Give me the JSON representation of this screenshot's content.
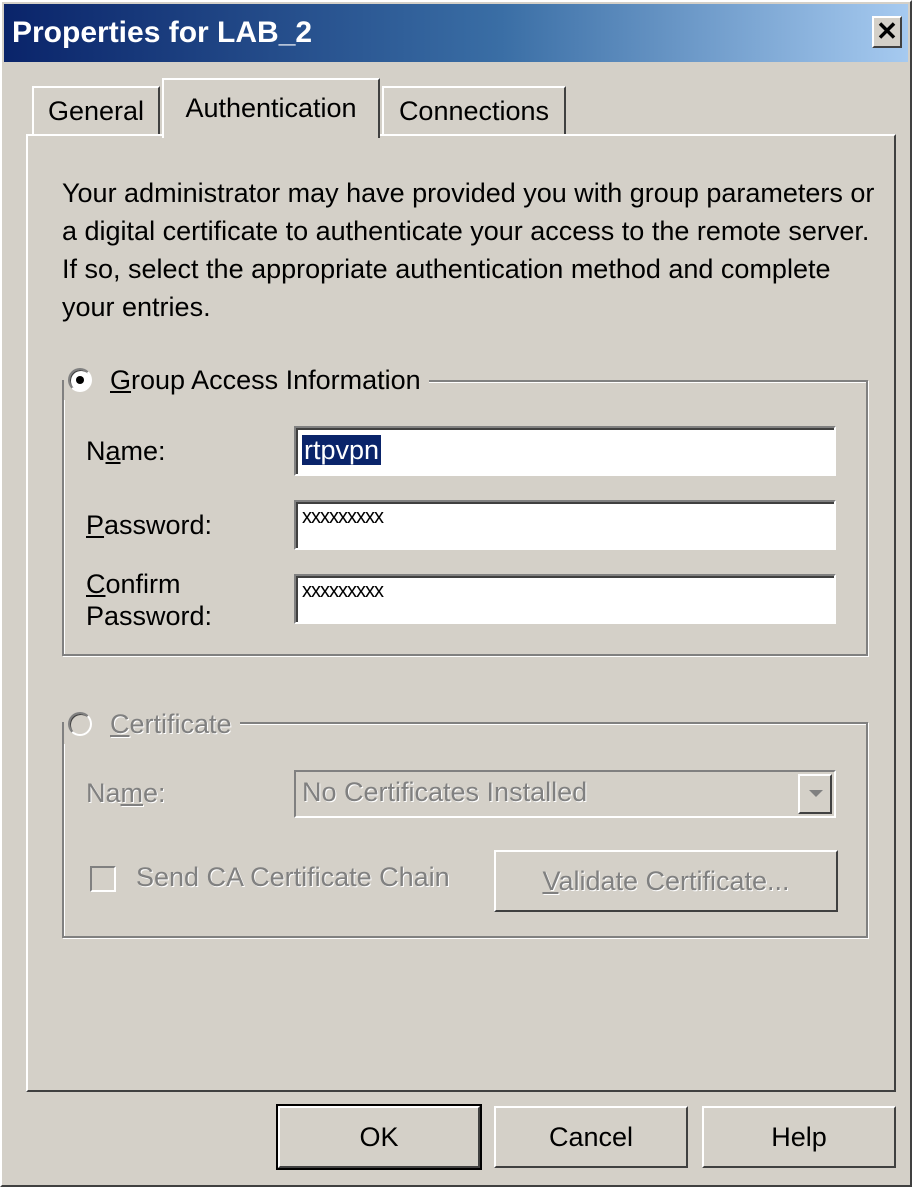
{
  "window": {
    "title": "Properties for LAB_2",
    "close_glyph": "✕"
  },
  "tabs": [
    {
      "label": "General",
      "active": false
    },
    {
      "label": "Authentication",
      "active": true
    },
    {
      "label": "Connections",
      "active": false
    }
  ],
  "intro_text": "Your administrator may have provided you with group parameters or a digital certificate to authenticate your access to the remote server.  If so, select the appropriate authentication method and complete your entries.",
  "group_access": {
    "legend_mnemonic": "G",
    "legend_rest": "roup Access Information",
    "selected": true,
    "name_label_a": "N",
    "name_label_m": "a",
    "name_label_b": "me:",
    "name_value": "rtpvpn",
    "password_label_m": "P",
    "password_label_b": "assword:",
    "password_value": "xxxxxxxxx",
    "confirm_label_line1_m": "C",
    "confirm_label_line1_b": "onfirm",
    "confirm_label_line2": "Password:",
    "confirm_value": "xxxxxxxxx"
  },
  "certificate": {
    "legend_mnemonic": "C",
    "legend_rest": "ertificate",
    "selected": false,
    "enabled": false,
    "name_label_a": "Na",
    "name_label_m": "m",
    "name_label_b": "e:",
    "combo_value": "No Certificates Installed",
    "send_chain_label": "Send CA Certificate Chain",
    "send_chain_checked": false,
    "validate_mnemonic": "V",
    "validate_rest": "alidate Certificate..."
  },
  "buttons": {
    "ok": "OK",
    "cancel": "Cancel",
    "help": "Help"
  },
  "colors": {
    "face": "#d4d0c8",
    "title_start": "#0a246a",
    "title_end": "#a6caf0",
    "disabled_text": "#808080",
    "selection": "#0a246a"
  }
}
